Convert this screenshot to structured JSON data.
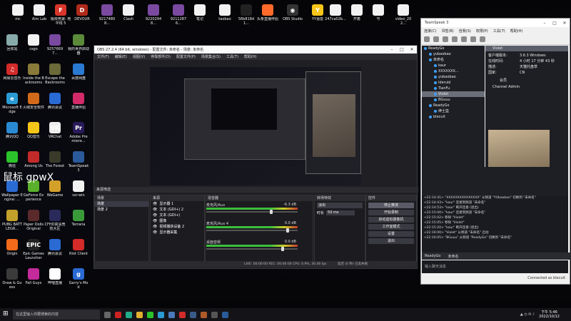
{
  "desktop_icons": [
    {
      "label": "mc",
      "color": "#f2f2f2",
      "glyph": ""
    },
    {
      "label": "Aim Lab",
      "color": "#f2f2f2",
      "glyph": ""
    },
    {
      "label": "极限竞速: 地平线 5",
      "color": "#d9352a",
      "glyph": "F"
    },
    {
      "label": "DEVOUR",
      "color": "#b02a1a",
      "glyph": "D"
    },
    {
      "label": "92174808...",
      "color": "#7a4aa0",
      "glyph": ""
    },
    {
      "label": "Clash",
      "color": "#f2f2f2",
      "glyph": ""
    },
    {
      "label": "92202948...",
      "color": "#7a4aa0",
      "glyph": ""
    },
    {
      "label": "92112876...",
      "color": "#7a4aa0",
      "glyph": ""
    },
    {
      "label": "笔记",
      "color": "#f2f2f2",
      "glyph": ""
    },
    {
      "label": "taobao",
      "color": "#f2f2f2",
      "glyph": ""
    },
    {
      "label": "58b818d1...",
      "color": "#222",
      "glyph": ""
    },
    {
      "label": "头条直播伴侣",
      "color": "#ff6a2a",
      "glyph": ""
    },
    {
      "label": "OBS Studio",
      "color": "#333",
      "glyph": "◉"
    },
    {
      "label": "YY语音",
      "color": "#f5c518",
      "glyph": "Y"
    },
    {
      "label": "247ca02b...",
      "color": "#f2f2f2",
      "glyph": ""
    },
    {
      "label": "开着",
      "color": "#f2f2f2",
      "glyph": ""
    },
    {
      "label": "号",
      "color": "#f2f2f2",
      "glyph": ""
    },
    {
      "label": "video_202...",
      "color": "#f2f2f2",
      "glyph": ""
    },
    {
      "label": "回收站",
      "color": "#8aa",
      "glyph": ""
    },
    {
      "label": "csgo",
      "color": "#f2f2f2",
      "glyph": ""
    },
    {
      "label": "92576697...",
      "color": "#7a4aa0",
      "glyph": ""
    },
    {
      "label": "我的世界启动器",
      "color": "#5a8a3a",
      "glyph": ""
    },
    {
      "label": "网易云音乐",
      "color": "#d32a2a",
      "glyph": "♫"
    },
    {
      "label": "Inside the Backrooms",
      "color": "#8a7a3a",
      "glyph": ""
    },
    {
      "label": "Escape the Backrooms",
      "color": "#6a6a3a",
      "glyph": ""
    },
    {
      "label": "百度网盘",
      "color": "#2a7ad3",
      "glyph": ""
    },
    {
      "label": "Microsoft Edge",
      "color": "#2a9ad3",
      "glyph": "e"
    },
    {
      "label": "火绒安全软件",
      "color": "#d36a1a",
      "glyph": ""
    },
    {
      "label": "腾讯会议",
      "color": "#2a6ad3",
      "glyph": ""
    },
    {
      "label": "直播伴侣",
      "color": "#d32a6a",
      "glyph": ""
    },
    {
      "label": "腾讯QQ",
      "color": "#2a8ad3",
      "glyph": ""
    },
    {
      "label": "QQ音乐",
      "color": "#f5c518",
      "glyph": ""
    },
    {
      "label": "VRChat",
      "color": "#eee",
      "glyph": "VR"
    },
    {
      "label": "Adobe Premiere...",
      "color": "#2a1a5a",
      "glyph": "Pr"
    },
    {
      "label": "微信",
      "color": "#2ac32a",
      "glyph": ""
    },
    {
      "label": "Among Us",
      "color": "#c32a2a",
      "glyph": ""
    },
    {
      "label": "The Forest",
      "color": "#3a3a2a",
      "glyph": ""
    },
    {
      "label": "TeamSpeak 3",
      "color": "#2a5a9a",
      "glyph": ""
    },
    {
      "label": "Wallpaper Engine: ...",
      "color": "#2a6ad3",
      "glyph": ""
    },
    {
      "label": "GeForce Experience",
      "color": "#5ab02a",
      "glyph": ""
    },
    {
      "label": "WeGame",
      "color": "#d3a02a",
      "glyph": ""
    },
    {
      "label": "ssr-win",
      "color": "#f2f2f2",
      "glyph": ""
    },
    {
      "label": "PUBG BATTLEGR...",
      "color": "#c3a02a",
      "glyph": ""
    },
    {
      "label": "Paper Dolls Original",
      "color": "#5a2a2a",
      "glyph": ""
    },
    {
      "label": "CFHD高清竞技大区",
      "color": "#2a2a5a",
      "glyph": ""
    },
    {
      "label": "Terraria",
      "color": "#3a9a3a",
      "glyph": ""
    },
    {
      "label": "Origin",
      "color": "#f26a1a",
      "glyph": ""
    },
    {
      "label": "Epic Games Launcher",
      "color": "#222",
      "glyph": "EPIC"
    },
    {
      "label": "腾讯会议",
      "color": "#2a6ad3",
      "glyph": ""
    },
    {
      "label": "Riot Client",
      "color": "#d32a2a",
      "glyph": ""
    },
    {
      "label": "Draw & Guess",
      "color": "#3a3a3a",
      "glyph": ""
    },
    {
      "label": "Fall Guys",
      "color": "#c32a9a",
      "glyph": ""
    },
    {
      "label": "哔哩直播",
      "color": "#fff",
      "glyph": ""
    },
    {
      "label": "Garry's Mod",
      "color": "#2a6ad3",
      "glyph": "g"
    }
  ],
  "watermark_text": "鼠标 gpwX",
  "obs": {
    "title": "OBS 27.2.4 (64 bit, windows) - 配置文件: 未命名 - 场景: 未命名",
    "menu": [
      "文件(F)",
      "编辑(E)",
      "视图(V)",
      "停靠部件(D)",
      "配置文件(P)",
      "场景集合(S)",
      "工具(T)",
      "帮助(H)"
    ],
    "scenes_header": "来源筛选",
    "scenes_col": "场景",
    "scenes": [
      "场景",
      "场景 2"
    ],
    "sources_header": "来源",
    "sources": [
      "显示器 1",
      "文本 (GDI+) 2",
      "文本 (GDI+)",
      "图像",
      "视频捕获设备 2",
      "显示器采集"
    ],
    "mixer_header": "混音器",
    "mixer": [
      {
        "name": "麦克风/Aux",
        "db": "-6.3 dB",
        "level": 0.72
      },
      {
        "name": "麦克风/Aux 4",
        "db": "0.0 dB",
        "level": 0.9
      },
      {
        "name": "桌面音频",
        "db": "0.0 dB",
        "level": 0.85
      }
    ],
    "transition_header": "转场特效",
    "transition_value": "淡出",
    "duration_label": "时长",
    "duration_value": "50 ms",
    "controls_header": "控件",
    "controls": [
      "停止推流",
      "开始录制",
      "启动虚拟摄像机",
      "工作室模式",
      "设置",
      "退出"
    ],
    "status": "LIVE: 00:00:00  REC: 00:00:00  CPU: 0.9%, 30.00 fps",
    "status_right": "延迟 (0 秒)  已丢失帧"
  },
  "teamspeak": {
    "title": "TeamSpeak 3",
    "menu": [
      "连接(C)",
      "书签(B)",
      "自我(S)",
      "权限(P)",
      "工具(T)",
      "帮助(H)"
    ],
    "server": "ReadyGo",
    "tree": [
      {
        "label": "ReadyGo",
        "indent": 0,
        "sel": false
      },
      {
        "label": "yubaobao",
        "indent": 1,
        "sel": false
      },
      {
        "label": "未命名",
        "indent": 1,
        "sel": false
      },
      {
        "label": "kaur",
        "indent": 2,
        "sel": false
      },
      {
        "label": "XXXXXXX...",
        "indent": 2,
        "sel": false
      },
      {
        "label": "yubaobao",
        "indent": 2,
        "sel": false
      },
      {
        "label": "lderuid",
        "indent": 2,
        "sel": false
      },
      {
        "label": "TianFu",
        "indent": 2,
        "sel": false
      },
      {
        "label": "Violet",
        "indent": 2,
        "sel": true
      },
      {
        "label": "BGuuu",
        "indent": 2,
        "sel": false
      },
      {
        "label": "ReadyGo",
        "indent": 1,
        "sel": false
      },
      {
        "label": "绅士篮",
        "indent": 2,
        "sel": false
      },
      {
        "label": "blecuit",
        "indent": 1,
        "sel": false
      }
    ],
    "info_name": "Violet",
    "info_rows": [
      {
        "k": "客户端版本:",
        "v": "3.6.3 Windows"
      },
      {
        "k": "在线时间:",
        "v": "4 小时 17 分钟 43 秒"
      },
      {
        "k": "描述:",
        "v": "天猫托盘草"
      },
      {
        "k": "国家:",
        "v": "CN"
      }
    ],
    "badge": "会员",
    "channel_admin": "Channel Admin",
    "chat_lines": [
      "<22:14:41> \"XXXXXXXXXXXXXXX\" 从频道 \"YUbaobao\" 切换到 \"未命名\"",
      "<22:14:43> \"kaur\" 连接到频道 \"未命名\"",
      "<22:14:53> \"kaur\" 断开连接 (退出)",
      "<22:15:00> \"kaur\" 连接到频道 \"未命名\"",
      "<22:15:02> 移除 \"Violet\"",
      "<22:15:05> 移除 \"Violet\"",
      "<22:15:20> \"kaur\" 断开连接 (退出)",
      "<22:16:00> \"Violet\" 从频道 \"未命名\" 启动",
      "<22:16:05> \"BGuuu\" 从频道 \"ReadyGo\" 切换到 \"未命名\""
    ],
    "chat_tab_server": "ReadyGo",
    "chat_tab_channel": "未命名",
    "input_placeholder": "输入聊天消息",
    "status_left": "Connected as",
    "status_right": "blecuit"
  },
  "taskbar": {
    "search_placeholder": "在这里输入你要搜索的内容",
    "time": "下午 5:46",
    "date": "2022/10/12"
  }
}
